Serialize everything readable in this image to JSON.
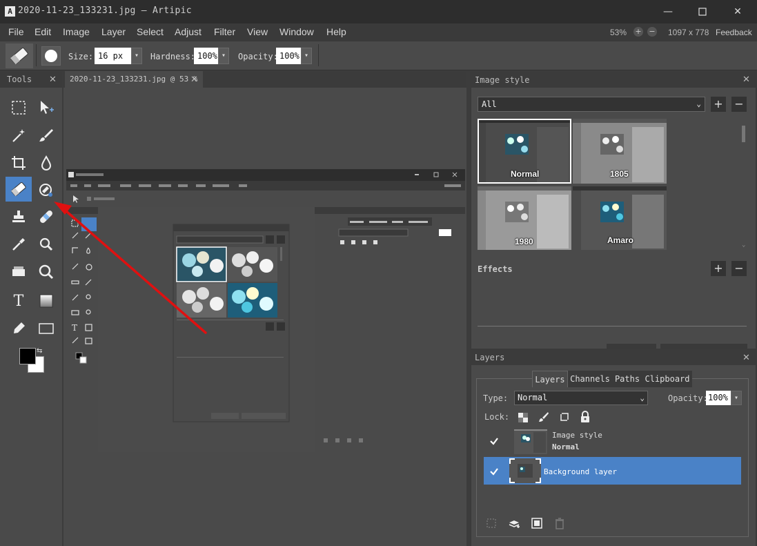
{
  "window": {
    "title": "2020-11-23_133231.jpg — Artipic",
    "logo": "A",
    "minimize_icon": "—",
    "maximize_icon": "☐",
    "close_icon": "✕"
  },
  "menu": [
    "File",
    "Edit",
    "Image",
    "Layer",
    "Select",
    "Adjust",
    "Filter",
    "View",
    "Window",
    "Help"
  ],
  "status": {
    "zoom": "53%",
    "zoom_in": "+",
    "zoom_out": "−",
    "image_size": "1097 x 778",
    "feedback": "Feedback"
  },
  "options": {
    "size_label": "Size:",
    "size_value": "16 px",
    "hardness_label": "Hardness:",
    "hardness_value": "100%",
    "opacity_label": "Opacity:",
    "opacity_value": "100%"
  },
  "tools_panel": {
    "title": "Tools",
    "close": "✕",
    "active_tool": "eraser",
    "tools": [
      "rect-select",
      "move",
      "magic-wand",
      "brush",
      "crop",
      "blur",
      "eraser",
      "color-replace",
      "stamp",
      "heal",
      "eyedropper",
      "magnifier",
      "fill",
      "zoom",
      "text",
      "gradient",
      "pen",
      "shape"
    ],
    "text_tool_glyph": "T"
  },
  "document": {
    "tab_title": "2020-11-23_133231.jpg @ 53 %",
    "tab_close": "✕"
  },
  "image_style": {
    "title": "Image style",
    "close": "✕",
    "filter_value": "All",
    "add": "+",
    "remove": "−",
    "styles": [
      {
        "name": "Normal",
        "selected": true
      },
      {
        "name": "1805",
        "selected": false
      },
      {
        "name": "1980",
        "selected": false
      },
      {
        "name": "Amaro",
        "selected": false
      }
    ],
    "effects_label": "Effects",
    "effects_add": "+",
    "effects_remove": "−"
  },
  "layers": {
    "title": "Layers",
    "close": "✕",
    "tabs": [
      "Layers",
      "Channels",
      "Paths",
      "Clipboard"
    ],
    "active_tab": "Layers",
    "type_label": "Type:",
    "type_value": "Normal",
    "opacity_label": "Opacity:",
    "opacity_value": "100%",
    "lock_label": "Lock:",
    "items": [
      {
        "name": "Image style",
        "sub": "Normal",
        "visible": true,
        "selected": false
      },
      {
        "name": "Background layer",
        "sub": "",
        "visible": true,
        "selected": true
      }
    ]
  },
  "colors": {
    "accent": "#4a82c7",
    "arrow": "#e01010",
    "foreground": "#000000",
    "background": "#ffffff"
  }
}
